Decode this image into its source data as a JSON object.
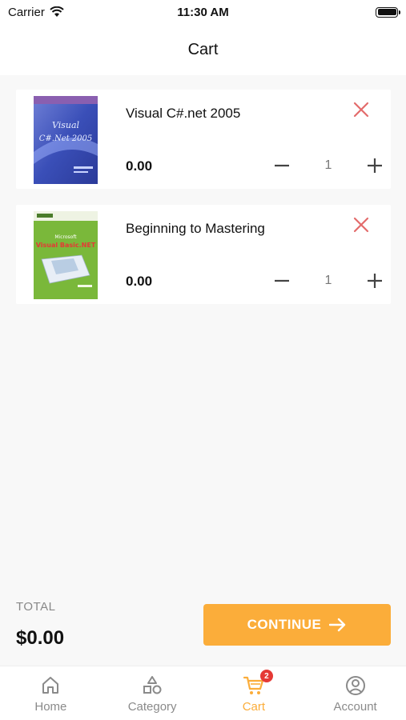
{
  "status_bar": {
    "carrier": "Carrier",
    "time": "11:30 AM"
  },
  "header": {
    "title": "Cart"
  },
  "cart": {
    "items": [
      {
        "title": "Visual C#.net 2005",
        "price": "0.00",
        "quantity": "1",
        "cover_text": "Visual C#.net 2005",
        "cover_color": "#3a5bbf"
      },
      {
        "title": "Beginning to Mastering",
        "price": "0.00",
        "quantity": "1",
        "cover_text": "Visual Basic.NET",
        "cover_color": "#8cc63f"
      }
    ]
  },
  "summary": {
    "total_label": "TOTAL",
    "total_value": "$0.00",
    "continue_label": "CONTINUE"
  },
  "tabs": [
    {
      "label": "Home",
      "icon": "home-icon",
      "active": false
    },
    {
      "label": "Category",
      "icon": "category-icon",
      "active": false
    },
    {
      "label": "Cart",
      "icon": "cart-icon",
      "active": true,
      "badge": "2"
    },
    {
      "label": "Account",
      "icon": "account-icon",
      "active": false
    }
  ],
  "colors": {
    "accent": "#fbad3a",
    "remove": "#e36b6b",
    "badge": "#e53935"
  }
}
